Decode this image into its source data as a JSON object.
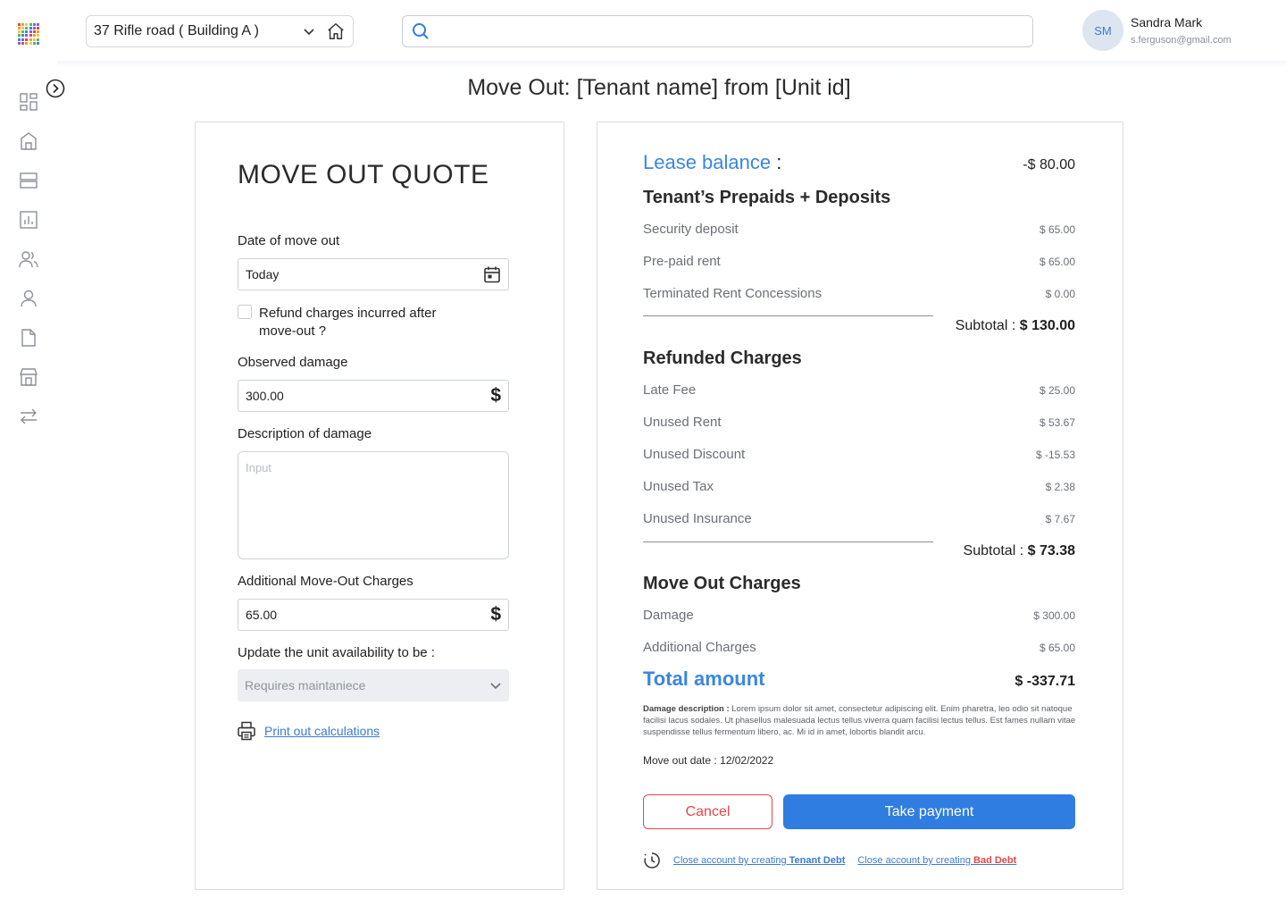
{
  "header": {
    "building": "37 Rifle road ( Building A )",
    "search_placeholder": "",
    "user_initials": "SM",
    "user_name": "Sandra Mark",
    "user_email": "s.ferguson@gmail.com"
  },
  "sidebar": {
    "items": [
      "dashboard-icon",
      "building-icon",
      "units-icon",
      "reports-icon",
      "tenants-icon",
      "user-icon",
      "document-icon",
      "store-icon",
      "transfer-icon"
    ]
  },
  "page_title": "Move Out: [Tenant name] from [Unit id]",
  "quote": {
    "title": "MOVE OUT QUOTE",
    "date_label": "Date of move out",
    "date_value": "Today",
    "refund_label": "Refund charges incurred after move-out ?",
    "damage_label": "Observed damage",
    "damage_value": "300.00",
    "desc_label": "Description of damage",
    "desc_placeholder": "Input",
    "additional_label": "Additional Move-Out Charges",
    "additional_value": "65.00",
    "availability_label": "Update the unit availability to be :",
    "availability_value": "Requires maintaniece",
    "print_label": "Print out calculations",
    "currency_symbol": "$"
  },
  "summary": {
    "lease_balance_label": "Lease balance",
    "lease_balance_value": "-$ 80.00",
    "prepaids_title": "Tenant’s Prepaids + Deposits",
    "prepaids": [
      {
        "label": "Security deposit",
        "value": "$ 65.00"
      },
      {
        "label": "Pre-paid rent",
        "value": "$ 65.00"
      },
      {
        "label": "Terminated Rent Concessions",
        "value": "$ 0.00"
      }
    ],
    "prepaids_subtotal_label": "Subtotal :",
    "prepaids_subtotal_value": "$ 130.00",
    "refunded_title": "Refunded Charges",
    "refunded": [
      {
        "label": "Late Fee",
        "value": "$ 25.00"
      },
      {
        "label": "Unused Rent",
        "value": "$ 53.67"
      },
      {
        "label": "Unused Discount",
        "value": "$ -15.53"
      },
      {
        "label": "Unused Tax",
        "value": "$ 2.38"
      },
      {
        "label": "Unused Insurance",
        "value": "$ 7.67"
      }
    ],
    "refunded_subtotal_label": "Subtotal :",
    "refunded_subtotal_value": "$ 73.38",
    "moveout_title": "Move Out Charges",
    "moveout": [
      {
        "label": "Damage",
        "value": "$ 300.00"
      },
      {
        "label": "Additional Charges",
        "value": "$ 65.00"
      }
    ],
    "total_label": "Total amount",
    "total_value": "$ -337.71",
    "damage_desc_label": "Damage description :",
    "damage_desc_text": "Lorem ipsum dolor sit amet, consectetur adipiscing elit. Enim pharetra, leo odio sit natoque facilisi lacus sodales. Ut phasellus malesuada lectus tellus viverra quam facilisi lectus tellus. Est fames nullam vitae suspendisse tellus fermentum libero, ac. Mi id in amet, lobortis blandit arcu.",
    "moveout_date_label": "Move out date :",
    "moveout_date_value": "12/02/2022",
    "cancel_label": "Cancel",
    "pay_label": "Take payment",
    "close_prefix": "Close account by creating",
    "tenant_debt": "Tenant Debt",
    "bad_debt": "Bad Debt"
  },
  "colors": {
    "accent": "#2f7de1",
    "danger": "#e04848"
  }
}
